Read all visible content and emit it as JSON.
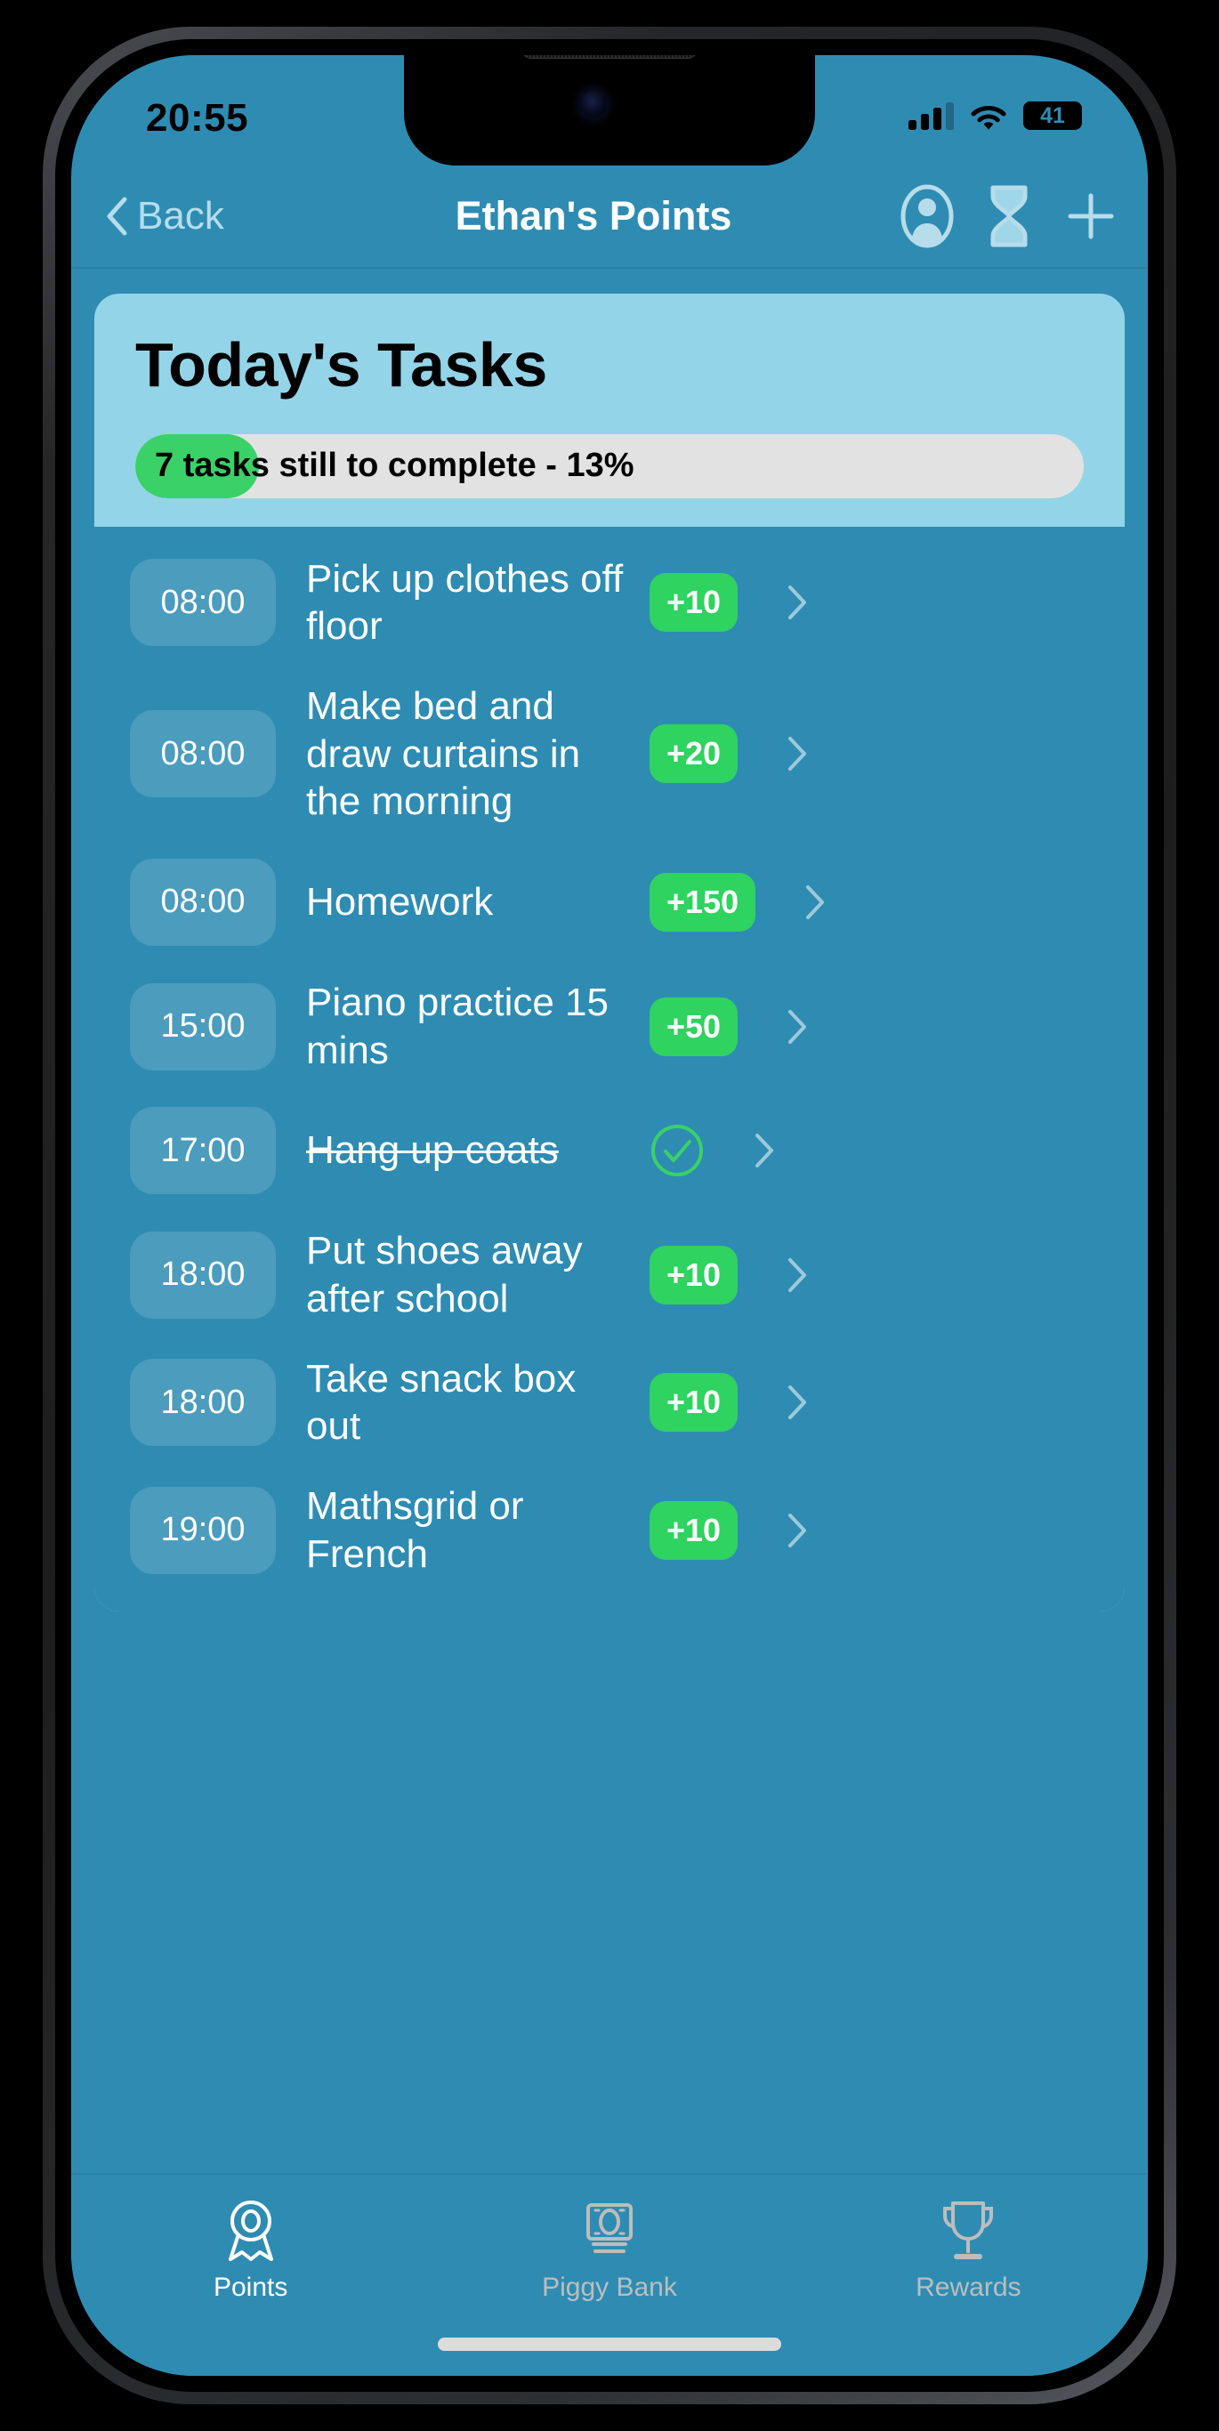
{
  "status_bar": {
    "time": "20:55",
    "battery_percent": "41",
    "battery_level": 41,
    "signal_bars_filled": 3,
    "signal_bars_total": 4,
    "wifi_icon": "wifi-icon",
    "battery_icon": "battery-icon"
  },
  "nav": {
    "back_label": "Back",
    "back_icon": "chevron-left-icon",
    "title": "Ethan's Points",
    "actions": [
      {
        "icon": "person-circle-icon",
        "name": "profile-button"
      },
      {
        "icon": "hourglass-icon",
        "name": "hourglass-button"
      },
      {
        "icon": "plus-icon",
        "name": "add-task-button"
      }
    ]
  },
  "card": {
    "title": "Today's Tasks",
    "progress": {
      "label": "7 tasks still to complete - 13%",
      "percent": 13,
      "remaining_tasks": 7,
      "fill_color": "#3ad168",
      "track_color": "#e2e2e2"
    }
  },
  "tasks": [
    {
      "time": "08:00",
      "title": "Pick up clothes off floor",
      "points": "+10",
      "completed": false
    },
    {
      "time": "08:00",
      "title": "Make bed and draw curtains in the morning",
      "points": "+20",
      "completed": false
    },
    {
      "time": "08:00",
      "title": "Homework",
      "points": "+150",
      "completed": false
    },
    {
      "time": "15:00",
      "title": "Piano practice 15 mins",
      "points": "+50",
      "completed": false
    },
    {
      "time": "17:00",
      "title": "Hang up coats",
      "points": "",
      "completed": true
    },
    {
      "time": "18:00",
      "title": "Put shoes away after school",
      "points": "+10",
      "completed": false
    },
    {
      "time": "18:00",
      "title": "Take snack box out",
      "points": "+10",
      "completed": false
    },
    {
      "time": "19:00",
      "title": "Mathsgrid or French",
      "points": "+10",
      "completed": false
    }
  ],
  "tab_bar": {
    "items": [
      {
        "label": "Points",
        "icon": "rosette-icon",
        "active": true
      },
      {
        "label": "Piggy Bank",
        "icon": "banknote-icon",
        "active": false
      },
      {
        "label": "Rewards",
        "icon": "trophy-icon",
        "active": false
      }
    ]
  },
  "colors": {
    "app_background": "#2e8cb3",
    "card_background": "#93d4e8",
    "points_badge": "#2fd35f",
    "progress_fill": "#3ad168",
    "accent_light": "#b7dcea",
    "check_green": "#3ad168"
  }
}
